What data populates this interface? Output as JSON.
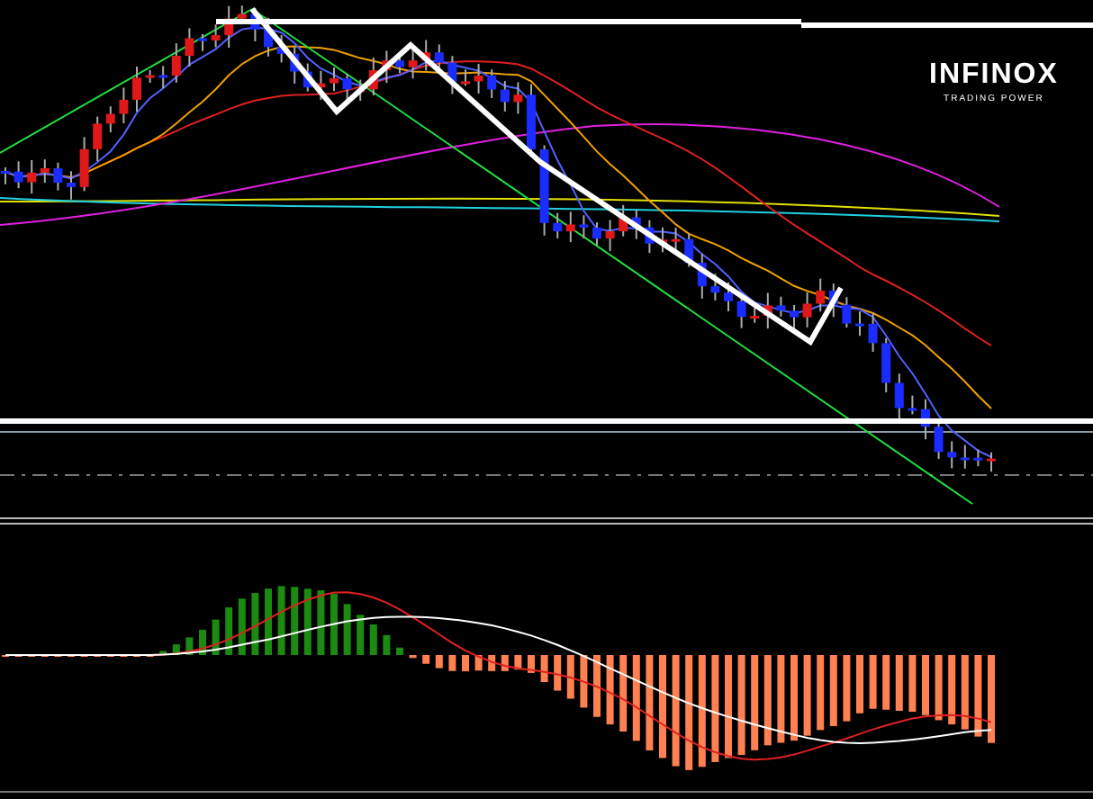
{
  "logo": {
    "name": "INFINOX",
    "tagline": "TRADING POWER"
  }
}
